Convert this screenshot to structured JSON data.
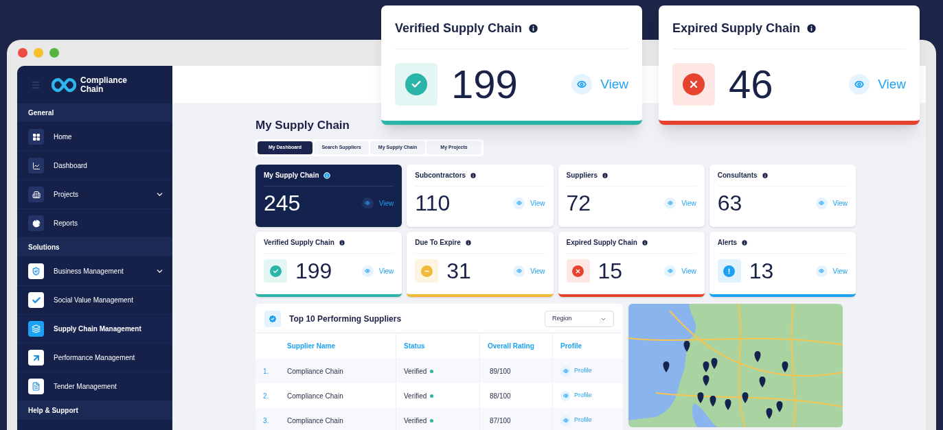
{
  "floating_cards": [
    {
      "title": "Verified Supply Chain",
      "value": "199",
      "link": "View",
      "kind": "verified"
    },
    {
      "title": "Expired Supply Chain",
      "value": "46",
      "link": "View",
      "kind": "expired"
    }
  ],
  "sidebar": {
    "logo_lines": [
      "Compliance",
      "Chain"
    ],
    "sections": [
      {
        "title": "General",
        "items": [
          {
            "label": "Home",
            "has_submenu": false,
            "selected": false
          },
          {
            "label": "Dashboard",
            "has_submenu": false,
            "selected": false
          },
          {
            "label": "Projects",
            "has_submenu": true,
            "selected": false
          },
          {
            "label": "Reports",
            "has_submenu": false,
            "selected": false
          }
        ]
      },
      {
        "title": "Solutions",
        "items": [
          {
            "label": "Business Management",
            "has_submenu": true,
            "selected": false
          },
          {
            "label": "Social Value Management",
            "has_submenu": false,
            "selected": false
          },
          {
            "label": "Supply Chain Management",
            "has_submenu": false,
            "selected": true
          },
          {
            "label": "Performance Management",
            "has_submenu": false,
            "selected": false
          },
          {
            "label": "Tender Management",
            "has_submenu": false,
            "selected": false
          }
        ]
      },
      {
        "title": "Help & Support"
      }
    ]
  },
  "page_title": "My Supply Chain",
  "tabs": [
    {
      "label": "My Dashboard",
      "selected": true
    },
    {
      "label": "Search Suppliers",
      "selected": false
    },
    {
      "label": "My Supply Chain",
      "selected": false
    },
    {
      "label": "My Projects",
      "selected": false
    }
  ],
  "stat_cards": [
    {
      "title": "My Supply Chain",
      "value": "245",
      "link": "View",
      "kind": "highlight"
    },
    {
      "title": "Subcontractors",
      "value": "110",
      "link": "View",
      "kind": "plain"
    },
    {
      "title": "Suppliers",
      "value": "72",
      "link": "View",
      "kind": "plain"
    },
    {
      "title": "Consultants",
      "value": "63",
      "link": "View",
      "kind": "plain"
    },
    {
      "title": "Verified Supply Chain",
      "value": "199",
      "link": "View",
      "kind": "verified"
    },
    {
      "title": "Due To Expire",
      "value": "31",
      "link": "View",
      "kind": "expiring"
    },
    {
      "title": "Expired Supply Chain",
      "value": "15",
      "link": "View",
      "kind": "expired"
    },
    {
      "title": "Alerts",
      "value": "13",
      "link": "View",
      "kind": "alert"
    }
  ],
  "suppliers_table": {
    "title": "Top 10 Performing Suppliers",
    "filter": "Region",
    "columns": [
      "Supplier Name",
      "Status",
      "Overall Rating",
      "Profile"
    ],
    "rows": [
      {
        "rank": "1.",
        "name": "Compliance Chain",
        "status": "Verified",
        "color": "#2bb5a0",
        "rating": "89/100",
        "profile": "Profile"
      },
      {
        "rank": "2.",
        "name": "Compliance Chain",
        "status": "Verified",
        "color": "#2bb5a0",
        "rating": "88/100",
        "profile": "Profile"
      },
      {
        "rank": "3.",
        "name": "Compliance Chain",
        "status": "Verified",
        "color": "#2bb5a0",
        "rating": "87/100",
        "profile": "Profile"
      }
    ]
  }
}
